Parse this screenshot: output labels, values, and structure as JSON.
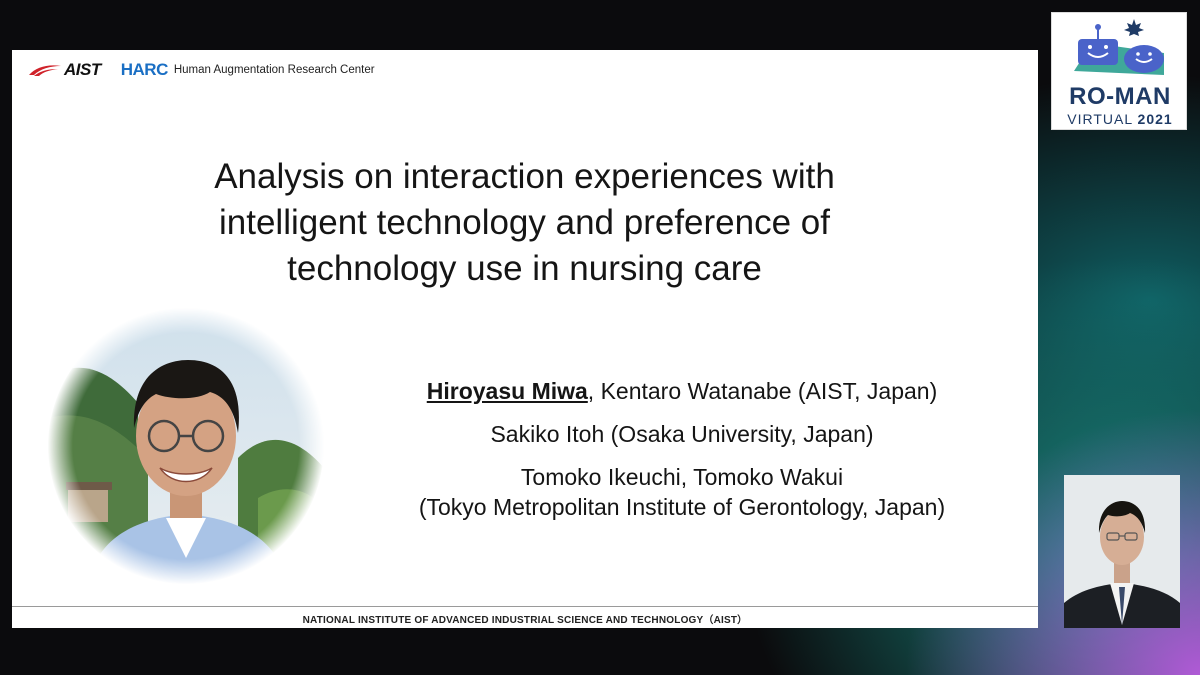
{
  "header": {
    "aist_logo_text": "AIST",
    "harc_logo_text": "HARC",
    "harc_full_name": "Human Augmentation Research Center"
  },
  "slide": {
    "title_lines": [
      "Analysis on interaction experiences with",
      "intelligent technology and preference of",
      "technology use in nursing care"
    ],
    "authors": {
      "presenter": "Hiroyasu Miwa",
      "line1_rest": ", Kentaro Watanabe (AIST, Japan)",
      "line2": "Sakiko Itoh (Osaka University, Japan)",
      "line3": "Tomoko Ikeuchi, Tomoko Wakui",
      "line4": "(Tokyo Metropolitan Institute of Gerontology, Japan)"
    },
    "footer": "NATIONAL INSTITUTE OF ADVANCED INDUSTRIAL SCIENCE AND TECHNOLOGY（AIST）"
  },
  "conference_badge": {
    "name": "RO-MAN",
    "sub_prefix": "VIRTUAL",
    "year": "2021"
  },
  "icons": {
    "aist_swoosh": "aist-swoosh-icon",
    "mascot": "robot-mascot-icon",
    "maple_leaf": "maple-leaf-icon"
  },
  "colors": {
    "harc_blue": "#1a6fc4",
    "aist_red": "#d0222a",
    "badge_navy": "#1f3b66",
    "badge_teal": "#3fa89a",
    "mascot_blue": "#4a63c9"
  }
}
